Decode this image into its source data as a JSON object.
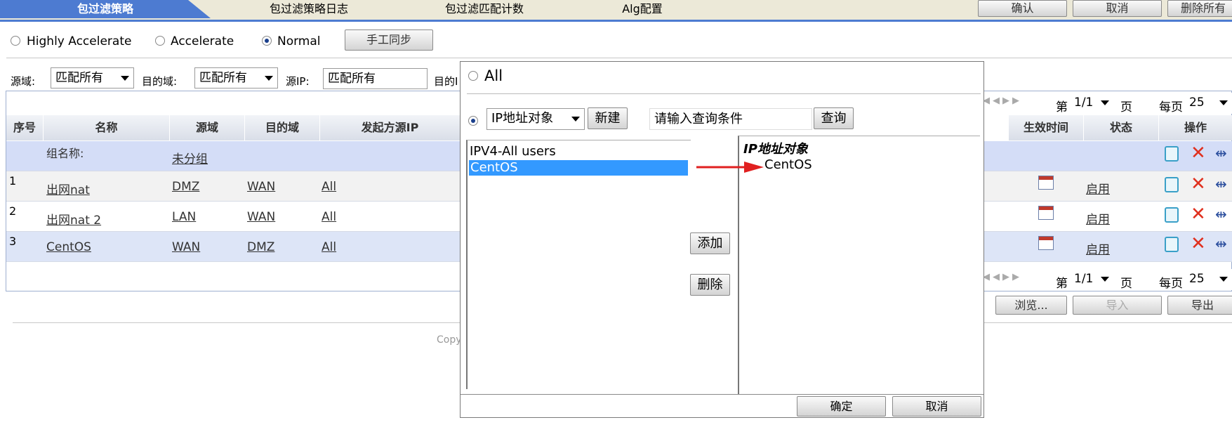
{
  "tabs": [
    {
      "label": "包过滤策略",
      "active": true
    },
    {
      "label": "包过滤策略日志"
    },
    {
      "label": "包过滤匹配计数"
    },
    {
      "label": "Alg配置"
    }
  ],
  "top_buttons": {
    "confirm": "确认",
    "cancel": "取消",
    "delete_all": "删除所有"
  },
  "modes": {
    "highly": "Highly Accelerate",
    "accelerate": "Accelerate",
    "normal": "Normal",
    "selected": "Normal"
  },
  "sync_button": "手工同步",
  "filters": {
    "src_zone_label": "源域:",
    "src_zone_value": "匹配所有",
    "dst_zone_label": "目的域:",
    "dst_zone_value": "匹配所有",
    "src_ip_label": "源IP:",
    "src_ip_value": "匹配所有",
    "dst_label_partial": "目的I"
  },
  "pagination": {
    "prefix": "第",
    "page": "1/1",
    "suffix": "页",
    "per_page_label": "每页",
    "per_page": "25"
  },
  "table": {
    "headers": {
      "index": "序号",
      "name": "名称",
      "src": "源域",
      "dst": "目的域",
      "src_ip": "发起方源IP",
      "time": "生效时间",
      "status": "状态",
      "ops": "操作"
    },
    "group_label": "组名称:",
    "group_value": "未分组",
    "rows": [
      {
        "index": "1",
        "name": "出网nat",
        "src": "DMZ",
        "dst": "WAN",
        "src_ip": "All",
        "status": "启用"
      },
      {
        "index": "2",
        "name": "出网nat 2",
        "src": "LAN",
        "dst": "WAN",
        "src_ip": "All",
        "status": "启用"
      },
      {
        "index": "3",
        "name": "CentOS",
        "src": "WAN",
        "dst": "DMZ",
        "src_ip": "All",
        "status": "启用"
      }
    ]
  },
  "bottom_buttons": {
    "browse": "浏览...",
    "import": "导入",
    "export": "导出"
  },
  "copyright_partial": "Copy",
  "dialog": {
    "all_label": "All",
    "type_select": "IP地址对象",
    "new_button": "新建",
    "query_placeholder": "请输入查询条件",
    "query_button": "查询",
    "left_list": [
      "IPV4-All users",
      "CentOS"
    ],
    "left_selected": "CentOS",
    "add_button": "添加",
    "remove_button": "删除",
    "right_header": "IP地址对象",
    "right_items": [
      "CentOS"
    ],
    "ok_button": "确定",
    "cancel_button": "取消"
  },
  "colors": {
    "tab_active": "#4d7bd1",
    "selected_row": "#3399ff",
    "arrow": "#e02020",
    "delete_icon": "#e0301e"
  }
}
